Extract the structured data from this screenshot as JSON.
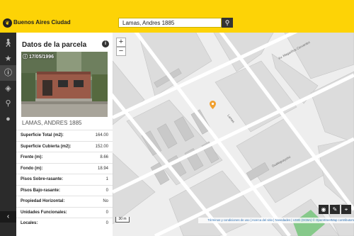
{
  "header": {
    "app_name": "Buenos Aires Ciudad",
    "search_value": "Lamas, Andres 1885",
    "search_icon": "magnifier",
    "logo_icon": "city-logo"
  },
  "sidebar": {
    "items": [
      {
        "icon": "person-walking"
      },
      {
        "icon": "star"
      },
      {
        "icon": "info"
      },
      {
        "icon": "layers"
      },
      {
        "icon": "search"
      },
      {
        "icon": "speech-bubble"
      }
    ],
    "collapse_label": "‹"
  },
  "panel": {
    "title": "Datos de la parcela",
    "photo_date": "17/05/1996",
    "owner": "LAMAS, ANDRES 1885",
    "attributes": [
      {
        "label": "Superficie Total (m2):",
        "value": "164.00"
      },
      {
        "label": "Superficie Cubierta (m2):",
        "value": "152.00"
      },
      {
        "label": "Frente (m):",
        "value": "8.66"
      },
      {
        "label": "Fondo (m):",
        "value": "18.94"
      },
      {
        "label": "Pisos Sobre-rasante:",
        "value": "1"
      },
      {
        "label": "Pisos Bajo-rasante:",
        "value": "0"
      },
      {
        "label": "Propiedad Horizontal:",
        "value": "No"
      },
      {
        "label": "Unidades Funcionales:",
        "value": "0"
      },
      {
        "label": "Locales:",
        "value": "0"
      }
    ]
  },
  "map": {
    "zoom_in": "+",
    "zoom_out": "−",
    "scale": "30 m",
    "street_labels": {
      "cervantes": "Av. Magariños Cervantes",
      "lamas": "Lamas",
      "other": "Gualeguaychú"
    },
    "attribution": "Términos y condiciones de uso | Acerca del sitio | Novedades | USIG (GCBA) © OpenStreetMap contributors",
    "tools": [
      "eye",
      "pencil",
      "locate"
    ],
    "colors": {
      "background": "#eeeeee",
      "blocks": "#dcdcdc",
      "buildings": "#c9c9c9",
      "park": "#86c98a",
      "marker": "#f0a030"
    }
  },
  "colors": {
    "accent": "#fdd306",
    "sidebar": "#2b2b2b"
  }
}
